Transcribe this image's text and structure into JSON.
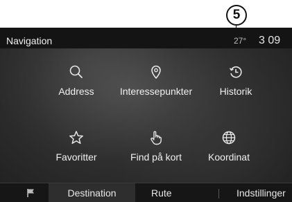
{
  "callout": {
    "number": "5"
  },
  "header": {
    "title": "Navigation",
    "temperature": "27°",
    "clock": "3 09"
  },
  "menu": {
    "address": "Address",
    "poi": "Interessepunkter",
    "history": "Historik",
    "favorites": "Favoritter",
    "find_on_map": "Find på kort",
    "coordinates": "Koordinat"
  },
  "tabs": {
    "destination": "Destination",
    "route": "Rute",
    "settings": "Indstillinger"
  },
  "icons": {
    "address": "search-icon",
    "poi": "location-pin-icon",
    "history": "history-clock-icon",
    "favorites": "star-icon",
    "find_on_map": "hand-pointer-icon",
    "coordinates": "globe-icon",
    "flag": "flag-icon"
  },
  "colors": {
    "background": "#2f2f2f",
    "bar": "#141414",
    "active_tab": "#2e2e2e",
    "text": "#efefef"
  }
}
